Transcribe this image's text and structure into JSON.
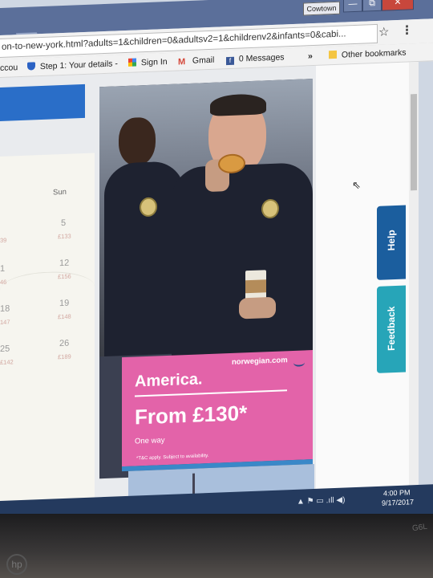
{
  "window": {
    "profile_name": "Cowtown",
    "buttons": {
      "minimize": "—",
      "maximize": "⧉",
      "close": "✕"
    }
  },
  "tab": {
    "close_icon": "×"
  },
  "address_bar": {
    "url": "on-to-new-york.html?adults=1&children=0&adultsv2=1&childrenv2&infants=0&cabi...",
    "star_icon": "☆",
    "menu_icon": "⋮"
  },
  "bookmarks": [
    {
      "label": "ccou",
      "icon": "partial-bookmark-icon"
    },
    {
      "label": "Step 1: Your details -",
      "icon": "shield-icon",
      "color": "#2b62c4"
    },
    {
      "label": "Sign In",
      "icon": "google-icon"
    },
    {
      "label": "Gmail",
      "icon": "gmail-icon",
      "color": "#d44638"
    },
    {
      "label": "0 Messages",
      "icon": "facebook-icon",
      "color": "#3b5998"
    },
    {
      "label": "»",
      "icon": "overflow-chevron-icon"
    },
    {
      "label": "Other bookmarks",
      "icon": "folder-icon",
      "color": "#f4c542"
    }
  ],
  "calendar": {
    "header": "Sun",
    "rows": [
      {
        "day_left": "",
        "price_left": "39",
        "day": "5",
        "price": "£133"
      },
      {
        "day_left": "1",
        "price_left": "46",
        "day": "12",
        "price": "£156"
      },
      {
        "day_left": "18",
        "price_left": "147",
        "day": "19",
        "price": "£148"
      },
      {
        "day_left": "25",
        "price_left": "£142",
        "day": "26",
        "price": "£189"
      }
    ]
  },
  "ad": {
    "brand": "norwegian.com",
    "headline": "America.",
    "price": "From £130*",
    "subtext": "One way",
    "terms": "*T&C apply. Subject to availability.",
    "accent_color": "#e363a9"
  },
  "side_tabs": {
    "help": "Help",
    "feedback": "Feedback"
  },
  "taskbar": {
    "tray_icons": "▲  ⚑  ▭  .ıll  ◀)",
    "time": "4:00 PM",
    "date": "9/17/2017"
  },
  "bezel": {
    "model": "G6L"
  }
}
